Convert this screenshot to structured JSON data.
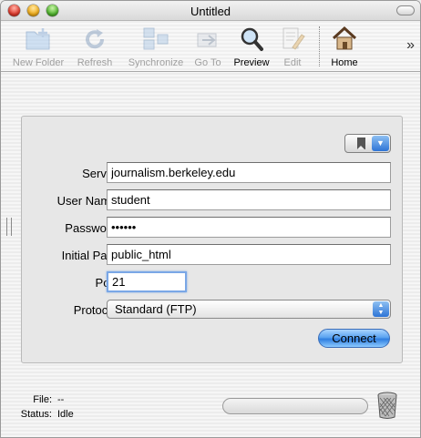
{
  "window": {
    "title": "Untitled"
  },
  "toolbar": {
    "items": [
      {
        "label": "New Folder",
        "icon": "new-folder-icon",
        "enabled": false
      },
      {
        "label": "Refresh",
        "icon": "refresh-icon",
        "enabled": false
      },
      {
        "label": "Synchronize",
        "icon": "synchronize-icon",
        "enabled": false
      },
      {
        "label": "Go To",
        "icon": "go-to-icon",
        "enabled": false
      },
      {
        "label": "Preview",
        "icon": "preview-icon",
        "enabled": true
      },
      {
        "label": "Edit",
        "icon": "edit-icon",
        "enabled": false
      },
      {
        "label": "Home",
        "icon": "home-icon",
        "enabled": true
      }
    ],
    "overflow_glyph": "»"
  },
  "connect_form": {
    "server_label": "Server:",
    "server_value": "journalism.berkeley.edu",
    "username_label": "User Name:",
    "username_value": "student",
    "password_label": "Password:",
    "password_value": "••••••",
    "initial_path_label": "Initial Path:",
    "initial_path_value": "public_html",
    "port_label": "Port:",
    "port_value": "21",
    "protocol_label": "Protocol:",
    "protocol_value": "Standard (FTP)",
    "connect_label": "Connect"
  },
  "status": {
    "file_label": "File:",
    "file_value": "--",
    "status_label": "Status:",
    "status_value": "Idle"
  },
  "colors": {
    "accent": "#2f7ee0",
    "focus_ring": "#7aa7e6"
  }
}
